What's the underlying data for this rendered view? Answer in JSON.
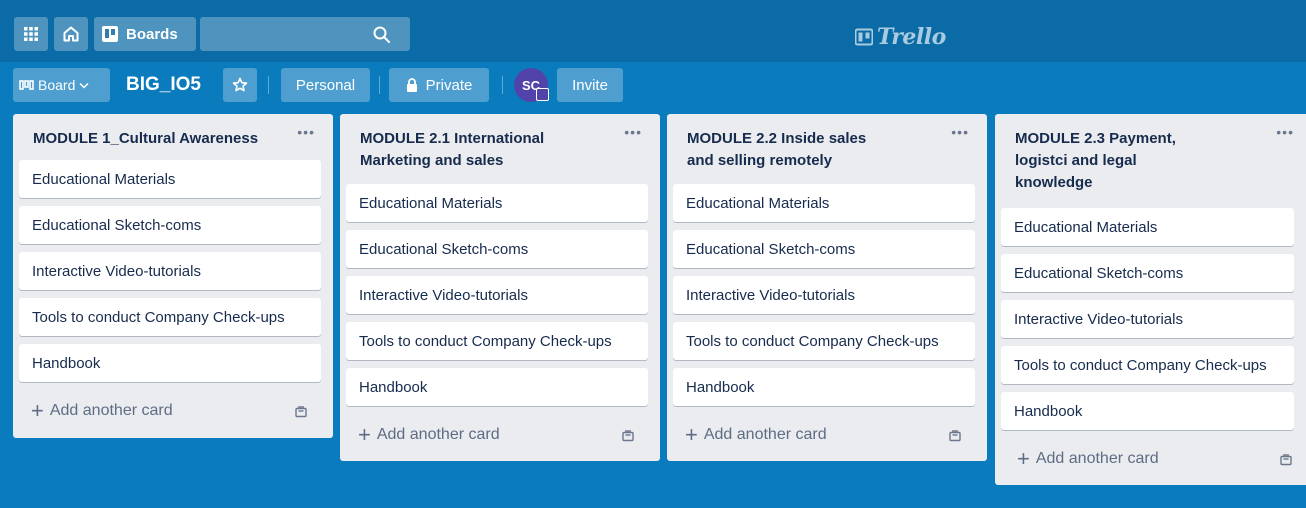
{
  "header": {
    "boards_label": "Boards",
    "logo_text": "Trello"
  },
  "board": {
    "menu_label": "Board",
    "title": "BIG_IO5",
    "visibility_team": "Personal",
    "visibility": "Private",
    "member_initials": "SC",
    "invite_label": "Invite"
  },
  "lists": [
    {
      "title": "MODULE 1_Cultural Awareness",
      "cards": [
        "Educational Materials",
        "Educational Sketch-coms",
        "Interactive Video-tutorials",
        "Tools to conduct Company Check-ups",
        "Handbook"
      ],
      "add_card_label": "Add another card"
    },
    {
      "title": "MODULE 2.1 International Marketing and sales",
      "cards": [
        "Educational Materials",
        "Educational Sketch-coms",
        "Interactive Video-tutorials",
        "Tools to conduct Company Check-ups",
        "Handbook"
      ],
      "add_card_label": "Add another card"
    },
    {
      "title": "MODULE 2.2 Inside sales and selling remotely",
      "cards": [
        "Educational Materials",
        "Educational Sketch-coms",
        "Interactive Video-tutorials",
        "Tools to conduct Company Check-ups",
        "Handbook"
      ],
      "add_card_label": "Add another card"
    },
    {
      "title": "MODULE 2.3 Payment, logistci and legal knowledge",
      "cards": [
        "Educational Materials",
        "Educational Sketch-coms",
        "Interactive Video-tutorials",
        "Tools to conduct Company Check-ups",
        "Handbook"
      ],
      "add_card_label": "Add another card"
    }
  ],
  "icons": {
    "apps": "grid-icon",
    "home": "home-icon",
    "boards": "boards-icon",
    "search": "search-icon",
    "board_menu": "board-view-icon",
    "menu_chevron": "chevron-down-icon",
    "star": "star-icon",
    "private": "lock-icon",
    "list_menu": "ellipsis-icon",
    "add": "plus-icon",
    "template": "card-template-icon"
  },
  "colors": {
    "background": "#0a7bbd",
    "header": "#0a6ba6",
    "list": "#ebecf0",
    "card": "#ffffff",
    "avatar": "#5243aa"
  }
}
